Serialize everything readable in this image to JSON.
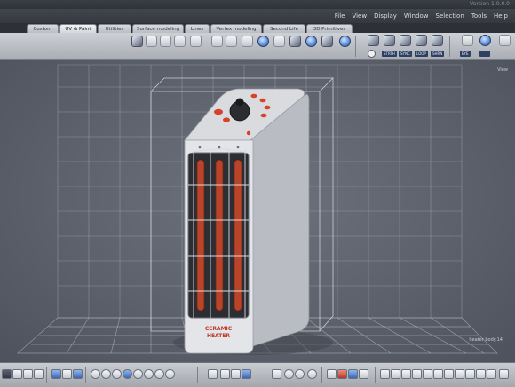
{
  "window": {
    "version_text": "Version 1.0.0.0"
  },
  "menu": [
    "File",
    "View",
    "Display",
    "Window",
    "Selection",
    "Tools",
    "Help"
  ],
  "tabs": [
    {
      "label": "Custom",
      "active": false
    },
    {
      "label": "UV & Paint",
      "active": true
    },
    {
      "label": "Utilities",
      "active": false
    },
    {
      "label": "Surface modeling",
      "active": false
    },
    {
      "label": "Lines",
      "active": false
    },
    {
      "label": "Vertex modeling",
      "active": false
    },
    {
      "label": "Second Life",
      "active": false
    },
    {
      "label": "3D Primitives",
      "active": false
    }
  ],
  "toolbar_small_labels": {
    "stretch": "STRTH",
    "sync": "SYNC",
    "loop": "LOOP",
    "shrink": "SHRN",
    "eye": "EYE"
  },
  "viewport": {
    "top_right_label": "View",
    "object_label": "heater body.14"
  },
  "model": {
    "front_text_line1": "CERAMIC",
    "front_text_line2": "HEATER"
  },
  "colors": {
    "accent_blue": "#4a7fd0",
    "heater_red": "#d8412c",
    "grid_line": "#c8ccd4"
  }
}
